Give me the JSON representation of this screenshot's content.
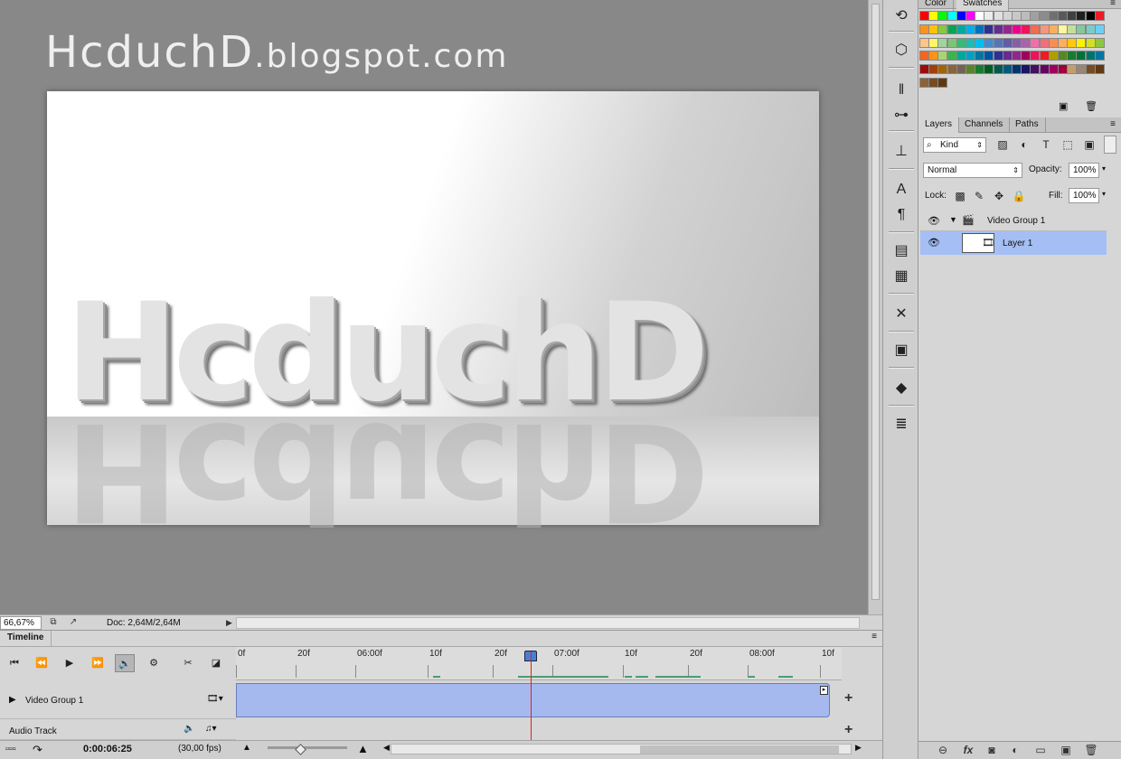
{
  "canvas": {
    "watermark_main": "HcduchD",
    "watermark_domain": ".blogspot.com",
    "artwork_text": "HcduchD"
  },
  "status": {
    "zoom": "66,67%",
    "doc_size": "Doc: 2,64M/2,64M"
  },
  "timeline": {
    "tab_label": "Timeline",
    "ruler_labels": [
      "0f",
      "20f",
      "06:00f",
      "10f",
      "20f",
      "07:00f",
      "10f",
      "20f",
      "08:00f",
      "10f"
    ],
    "tracks": [
      {
        "name": "Video Group 1"
      },
      {
        "name": "Audio Track"
      }
    ],
    "current_time": "0:00:06:25",
    "fps": "(30,00 fps)"
  },
  "swatches_panel": {
    "tabs": [
      "Color",
      "Swatches"
    ],
    "active_tab": "Swatches",
    "colors": [
      "#ff0000",
      "#ffff00",
      "#00ff00",
      "#00ffff",
      "#0000ff",
      "#ff00ff",
      "#ffffff",
      "#ebebeb",
      "#e0e0e0",
      "#d4d4d4",
      "#c8c8c8",
      "#bcbcbc",
      "#a0a0a0",
      "#8c8c8c",
      "#707070",
      "#595959",
      "#404040",
      "#1f1f1f",
      "#000000",
      "#ed1c24",
      "#f7941d",
      "#ffc20e",
      "#8dc63f",
      "#00a651",
      "#00a99d",
      "#00aeef",
      "#0072bc",
      "#2e3192",
      "#662d91",
      "#92278f",
      "#ec008c",
      "#ed145b",
      "#f26c4f",
      "#f7977a",
      "#fbaf5d",
      "#fff799",
      "#c4df9b",
      "#82ca9c",
      "#7accc8",
      "#6dcff6",
      "#fdc689",
      "#fff568",
      "#a3d39c",
      "#7cc576",
      "#3cb878",
      "#1cbbb4",
      "#00bff3",
      "#448ccb",
      "#5674b9",
      "#605ca8",
      "#8560a8",
      "#a864a8",
      "#f06eaa",
      "#f26d7d",
      "#f68e56",
      "#fbaf5d",
      "#ffc90e",
      "#fff200",
      "#d7df23",
      "#8dc63f",
      "#f26522",
      "#f7941d",
      "#acd373",
      "#39b54a",
      "#00a99d",
      "#00a0c6",
      "#0076a3",
      "#0054a6",
      "#2e3192",
      "#662d91",
      "#92278f",
      "#9e005d",
      "#ed145b",
      "#ed1c24",
      "#aba000",
      "#598527",
      "#1a7b30",
      "#007236",
      "#00746b",
      "#0076a3",
      "#9e0b0f",
      "#a0410d",
      "#a36209",
      "#8c6239",
      "#736357",
      "#598527",
      "#197b30",
      "#005e20",
      "#005952",
      "#005b7f",
      "#003471",
      "#1b1464",
      "#440e62",
      "#630460",
      "#9e005d",
      "#9e0039",
      "#c69c6d",
      "#998675",
      "#754c24",
      "#603913",
      "#8c6239",
      "#754c24",
      "#603913"
    ]
  },
  "layers_panel": {
    "tabs": [
      "Layers",
      "Channels",
      "Paths"
    ],
    "active_tab": "Layers",
    "filter_kind": "Kind",
    "blend_mode": "Normal",
    "opacity_label": "Opacity:",
    "opacity_value": "100%",
    "lock_label": "Lock:",
    "fill_label": "Fill:",
    "fill_value": "100%",
    "layers": [
      {
        "name": "Video Group 1",
        "type": "group",
        "visible": true
      },
      {
        "name": "Layer 1",
        "type": "video-layer",
        "visible": true,
        "selected": true
      }
    ]
  }
}
